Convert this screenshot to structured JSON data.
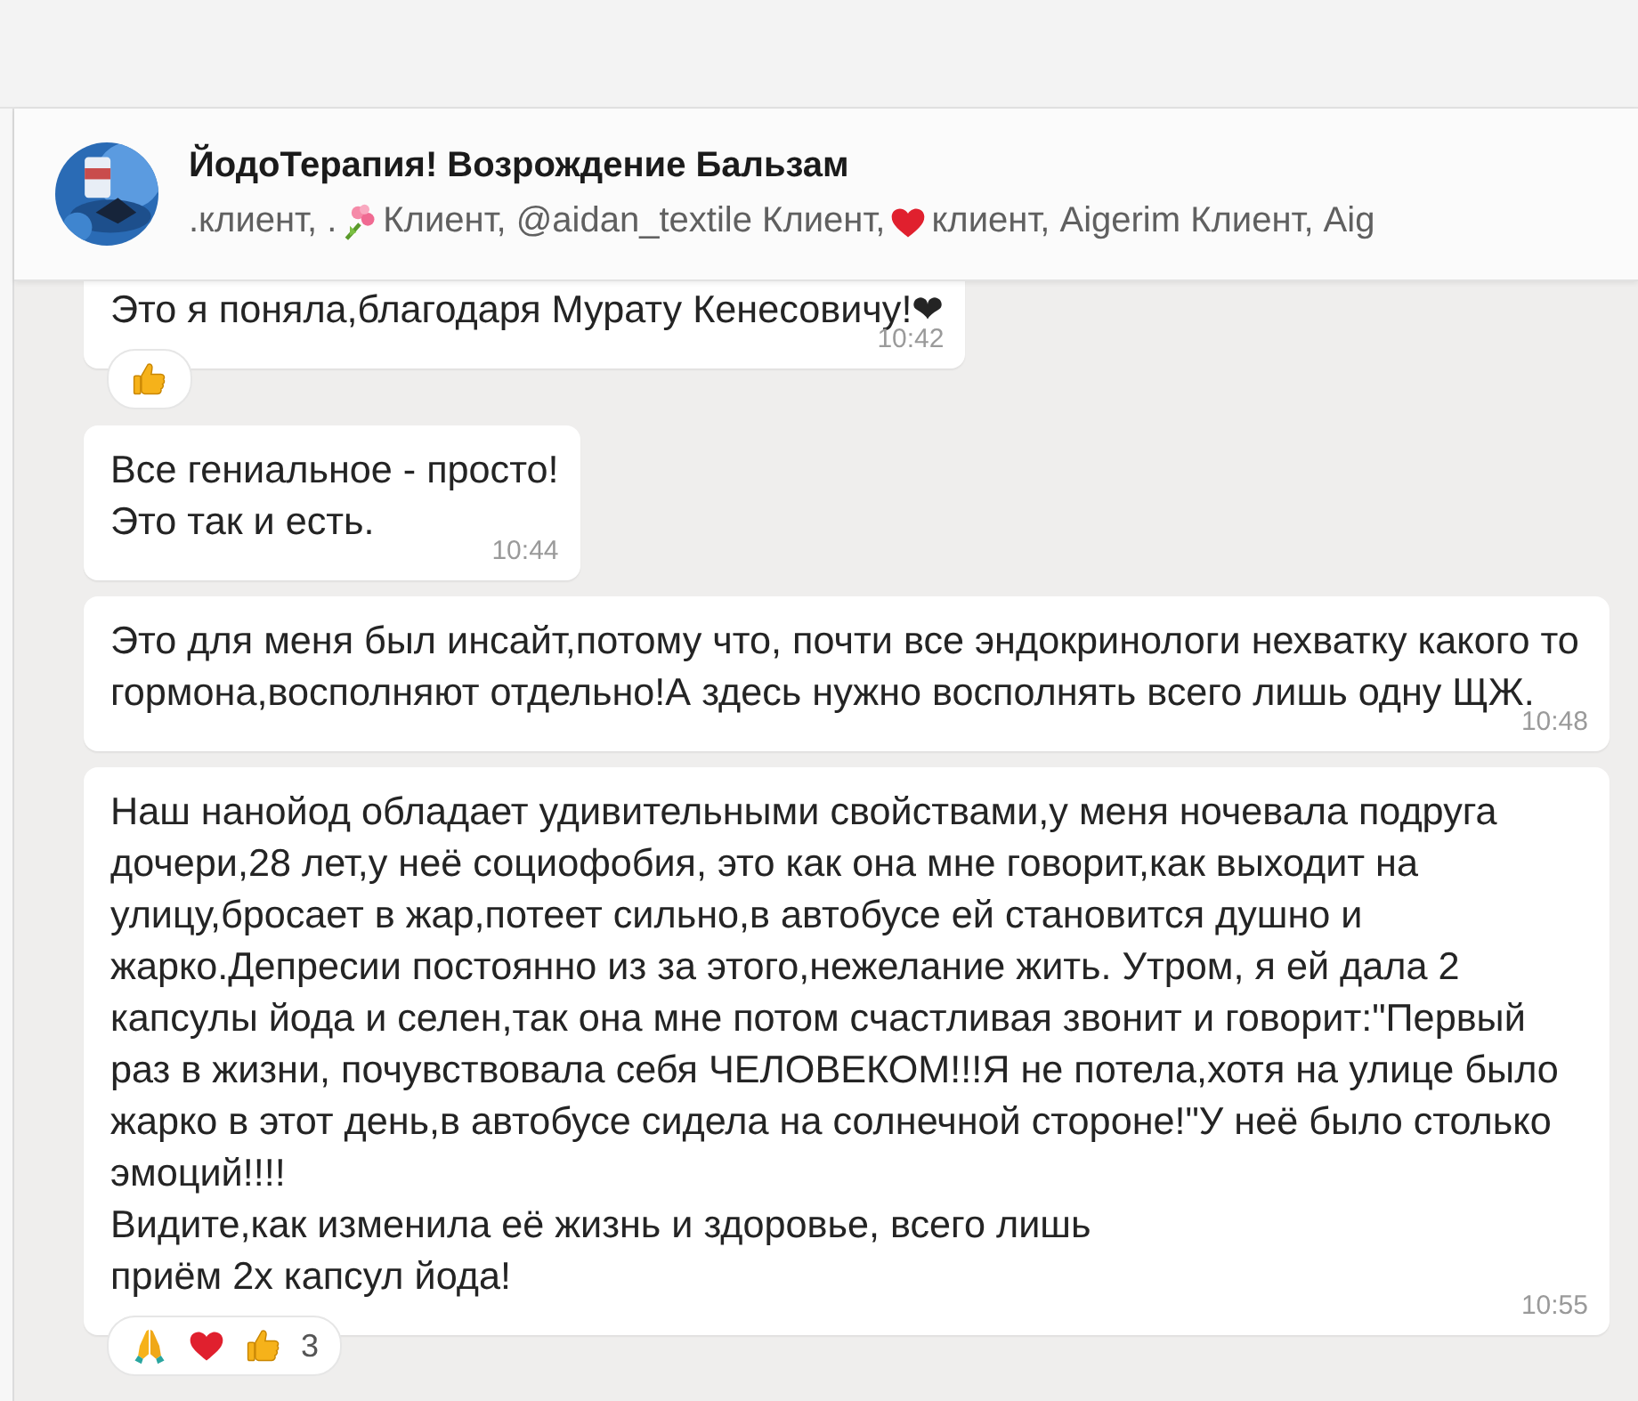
{
  "chat": {
    "title": "ЙодоТерапия! Возрождение Бальзам",
    "members": [
      {
        "kind": "text",
        "text": ".клиент, ."
      },
      {
        "kind": "bouquet"
      },
      {
        "kind": "text",
        "text": " Клиент, @aidan_textile Клиент, "
      },
      {
        "kind": "heart"
      },
      {
        "kind": "text",
        "text": "клиент, Aigerim Клиент, Aig"
      }
    ]
  },
  "messages": [
    {
      "text": "Это я поняла,благодаря Мурату Кенесовичу!❤",
      "time": "10:42",
      "reactions": [
        {
          "kind": "thumbs_up"
        }
      ]
    },
    {
      "text": "Все гениальное - просто!\nЭто так и есть.",
      "time": "10:44"
    },
    {
      "text": "Это для меня был инсайт,потому что, почти все эндокринологи нехватку какого то гормона,восполняют отдельно!А здесь нужно восполнять всего лишь одну ЩЖ.",
      "time": "10:48"
    },
    {
      "text": "Наш нанойод обладает удивительными свойствами,у меня ночевала подруга дочери,28 лет,у неё социофобия, это как она мне говорит,как выходит на улицу,бросает в жар,потеет сильно,в автобусе ей становится душно и жарко.Депресии постоянно из за этого,нежелание жить. Утром, я ей дала 2 капсулы йода и селен,так она мне потом счастливая звонит и говорит:\"Первый раз в жизни, почувствовала себя ЧЕЛОВЕКОМ!!!Я не потела,хотя на улице было жарко в этот день,в автобусе сидела на солнечной стороне!\"У неё было столько эмоций!!!!\nВидите,как изменила её жизнь и здоровье, всего лишь\nприём 2х капсул йода!",
      "time": "10:55",
      "reactions": [
        {
          "kind": "praying_hands"
        },
        {
          "kind": "heart"
        },
        {
          "kind": "thumbs_up"
        }
      ],
      "reaction_count": "3"
    }
  ]
}
